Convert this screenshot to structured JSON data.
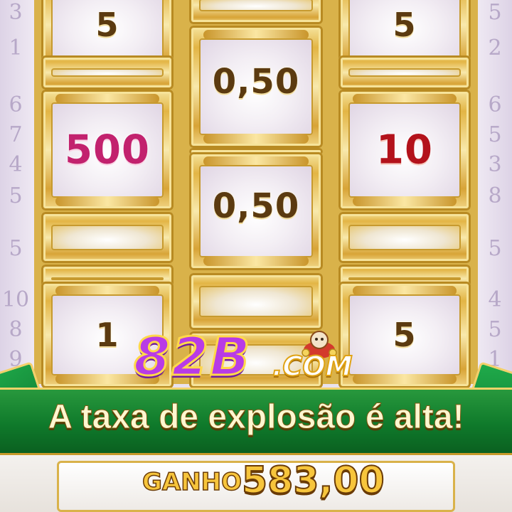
{
  "side_left": [
    "3",
    "1",
    "6",
    "7",
    "4",
    "5",
    "5",
    "10",
    "8",
    "9"
  ],
  "side_right": [
    "6",
    "5",
    "3",
    "8",
    "5",
    "4",
    "5",
    "1",
    "5",
    "2"
  ],
  "reels": [
    {
      "tiles": [
        {
          "value": "5",
          "color": "brown"
        },
        {
          "value": "",
          "color": "plain"
        },
        {
          "value": "500",
          "color": "pink"
        },
        {
          "value": "",
          "color": "plain"
        },
        {
          "value": "",
          "color": "plain"
        },
        {
          "value": "1",
          "color": "brown"
        }
      ]
    },
    {
      "tiles": [
        {
          "value": "",
          "color": "plain"
        },
        {
          "value": "0,50",
          "color": "brown"
        },
        {
          "value": "",
          "color": "plain"
        },
        {
          "value": "0,50",
          "color": "brown"
        },
        {
          "value": "",
          "color": "plain"
        },
        {
          "value": "",
          "color": "plain"
        }
      ]
    },
    {
      "tiles": [
        {
          "value": "5",
          "color": "brown"
        },
        {
          "value": "",
          "color": "plain"
        },
        {
          "value": "10",
          "color": "red"
        },
        {
          "value": "",
          "color": "plain"
        },
        {
          "value": "",
          "color": "plain"
        },
        {
          "value": "5",
          "color": "brown"
        }
      ]
    }
  ],
  "logo": {
    "main": "82B",
    "domain": ".COM"
  },
  "banner": {
    "text": "A taxa de explosão é alta!"
  },
  "win": {
    "label": "GANHO",
    "value": "583,00"
  },
  "colors": {
    "gold": "#d9b24a",
    "green": "#0f7a2b",
    "pink": "#c2226e",
    "red": "#b3121b",
    "brown": "#5b3a10"
  }
}
